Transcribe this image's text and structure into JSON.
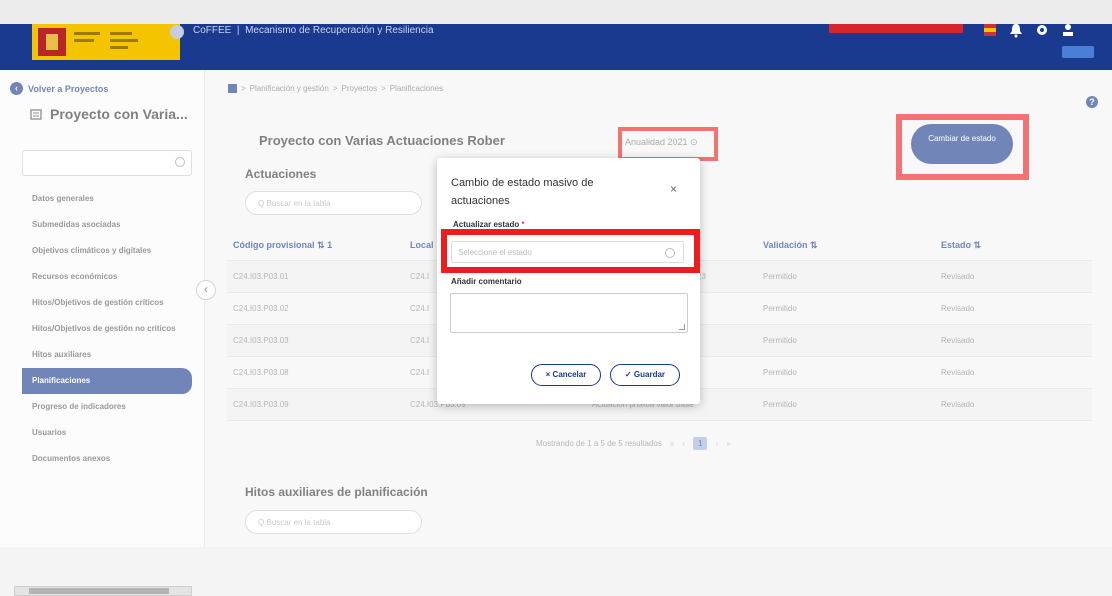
{
  "header": {
    "app_name": "CoFFEE",
    "separator": "|",
    "subtitle": "Mecanismo de Recuperación y Resiliencia",
    "icons": [
      "flag-icon",
      "bell-icon",
      "gear-icon",
      "user-icon"
    ]
  },
  "sidebar": {
    "back_label": "Volver a Proyectos",
    "project_title": "Proyecto con Varia...",
    "search_placeholder": "",
    "items": [
      {
        "label": "Datos generales",
        "active": false
      },
      {
        "label": "Submedidas asociadas",
        "active": false
      },
      {
        "label": "Objetivos climáticos y digitales",
        "active": false
      },
      {
        "label": "Recursos económicos",
        "active": false
      },
      {
        "label": "Hitos/Objetivos de gestión críticos",
        "active": false
      },
      {
        "label": "Hitos/Objetivos de gestión no criticos",
        "active": false
      },
      {
        "label": "Hitos auxiliares",
        "active": false
      },
      {
        "label": "Planificaciones",
        "active": true
      },
      {
        "label": "Progreso de indicadores",
        "active": false
      },
      {
        "label": "Usuarios",
        "active": false
      },
      {
        "label": "Documentos anexos",
        "active": false
      }
    ]
  },
  "breadcrumb": {
    "items": [
      "Planificación y gestión",
      "Proyectos",
      "Planificaciones"
    ],
    "sep": ">"
  },
  "main": {
    "title": "Proyecto con Varias Actuaciones Rober",
    "anualidad": "Anualidad 2021",
    "cambiar_estado": "Cambiar de estado",
    "section_actuaciones": "Actuaciones",
    "search_placeholder": "Buscar en la tabla",
    "section_hitos": "Hitos auxiliares de planificación",
    "search2_placeholder": "Buscar en la tabla"
  },
  "table": {
    "columns": [
      "Código provisional",
      "Local",
      "Validación",
      "Estado"
    ],
    "sort_first": "1",
    "rows": [
      {
        "codigo": "C24.I03.P03.01",
        "local": "C24.I",
        "desc": "23",
        "validacion": "Permitido",
        "estado": "Revisado"
      },
      {
        "codigo": "C24.I03.P03.02",
        "local": "C24.I",
        "desc": "",
        "validacion": "Permitido",
        "estado": "Revisado"
      },
      {
        "codigo": "C24.I03.P03.03",
        "local": "C24.I",
        "desc": "",
        "validacion": "Permitido",
        "estado": "Revisado"
      },
      {
        "codigo": "C24.I03.P03.08",
        "local": "C24.I",
        "desc": "",
        "validacion": "Permitido",
        "estado": "Revisado"
      },
      {
        "codigo": "C24.I03.P03.09",
        "local": "C24.I03.P03.09",
        "desc": "Actuación prueba valor base",
        "validacion": "Permitido",
        "estado": "Revisado"
      }
    ],
    "pagination": {
      "summary": "Mostrando de 1 a 5 de 5 resultados",
      "first": "«",
      "prev": "‹",
      "page": "1",
      "next": "›",
      "last": "»"
    }
  },
  "modal": {
    "title": "Cambio de estado masivo de actuaciones",
    "close": "×",
    "estado_label": "Actualizar estado",
    "required_mark": "*",
    "estado_placeholder": "Seleccione el estado",
    "comment_label": "Añadir comentario",
    "cancel": "Cancelar",
    "save": "Guardar"
  },
  "colors": {
    "brand": "#1a3a8f",
    "highlight": "#ee1c1c"
  }
}
